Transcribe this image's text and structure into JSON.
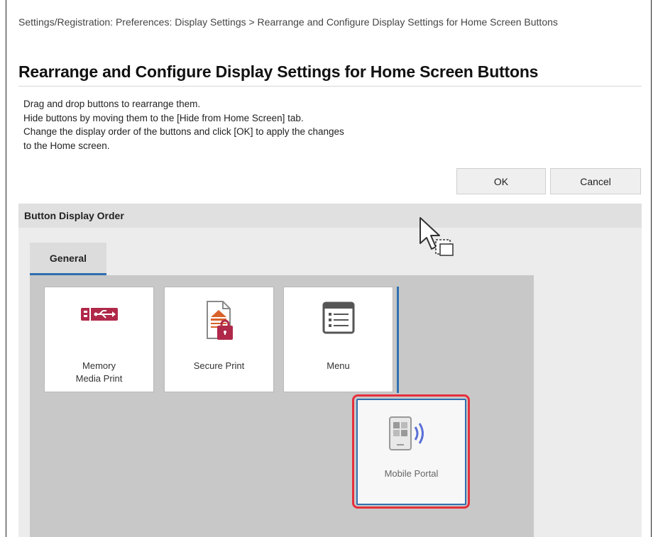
{
  "breadcrumb": "Settings/Registration: Preferences: Display Settings > Rearrange and Configure Display Settings for Home Screen Buttons",
  "page_title": "Rearrange and Configure Display Settings for Home Screen Buttons",
  "instructions": [
    "Drag and drop buttons to rearrange them.",
    "Hide buttons by moving them to the [Hide from Home Screen] tab.",
    "Change the display order of the buttons and click [OK] to apply the changes",
    "to the Home screen."
  ],
  "buttons": {
    "ok": "OK",
    "cancel": "Cancel"
  },
  "section": {
    "title": "Button Display Order",
    "tab": "General",
    "tiles": [
      {
        "label_line1": "Memory",
        "label_line2": "Media Print",
        "icon": "memory-media-icon"
      },
      {
        "label_line1": "Secure Print",
        "label_line2": "",
        "icon": "secure-print-icon"
      },
      {
        "label_line1": "Menu",
        "label_line2": "",
        "icon": "menu-icon"
      }
    ],
    "dragging_tile": {
      "label": "Mobile Portal",
      "icon": "mobile-portal-icon"
    }
  },
  "colors": {
    "accent": "#2f6fb0",
    "highlight": "#e5303c",
    "usb_icon": "#b0294a",
    "doc_icon": "#d9622b"
  }
}
